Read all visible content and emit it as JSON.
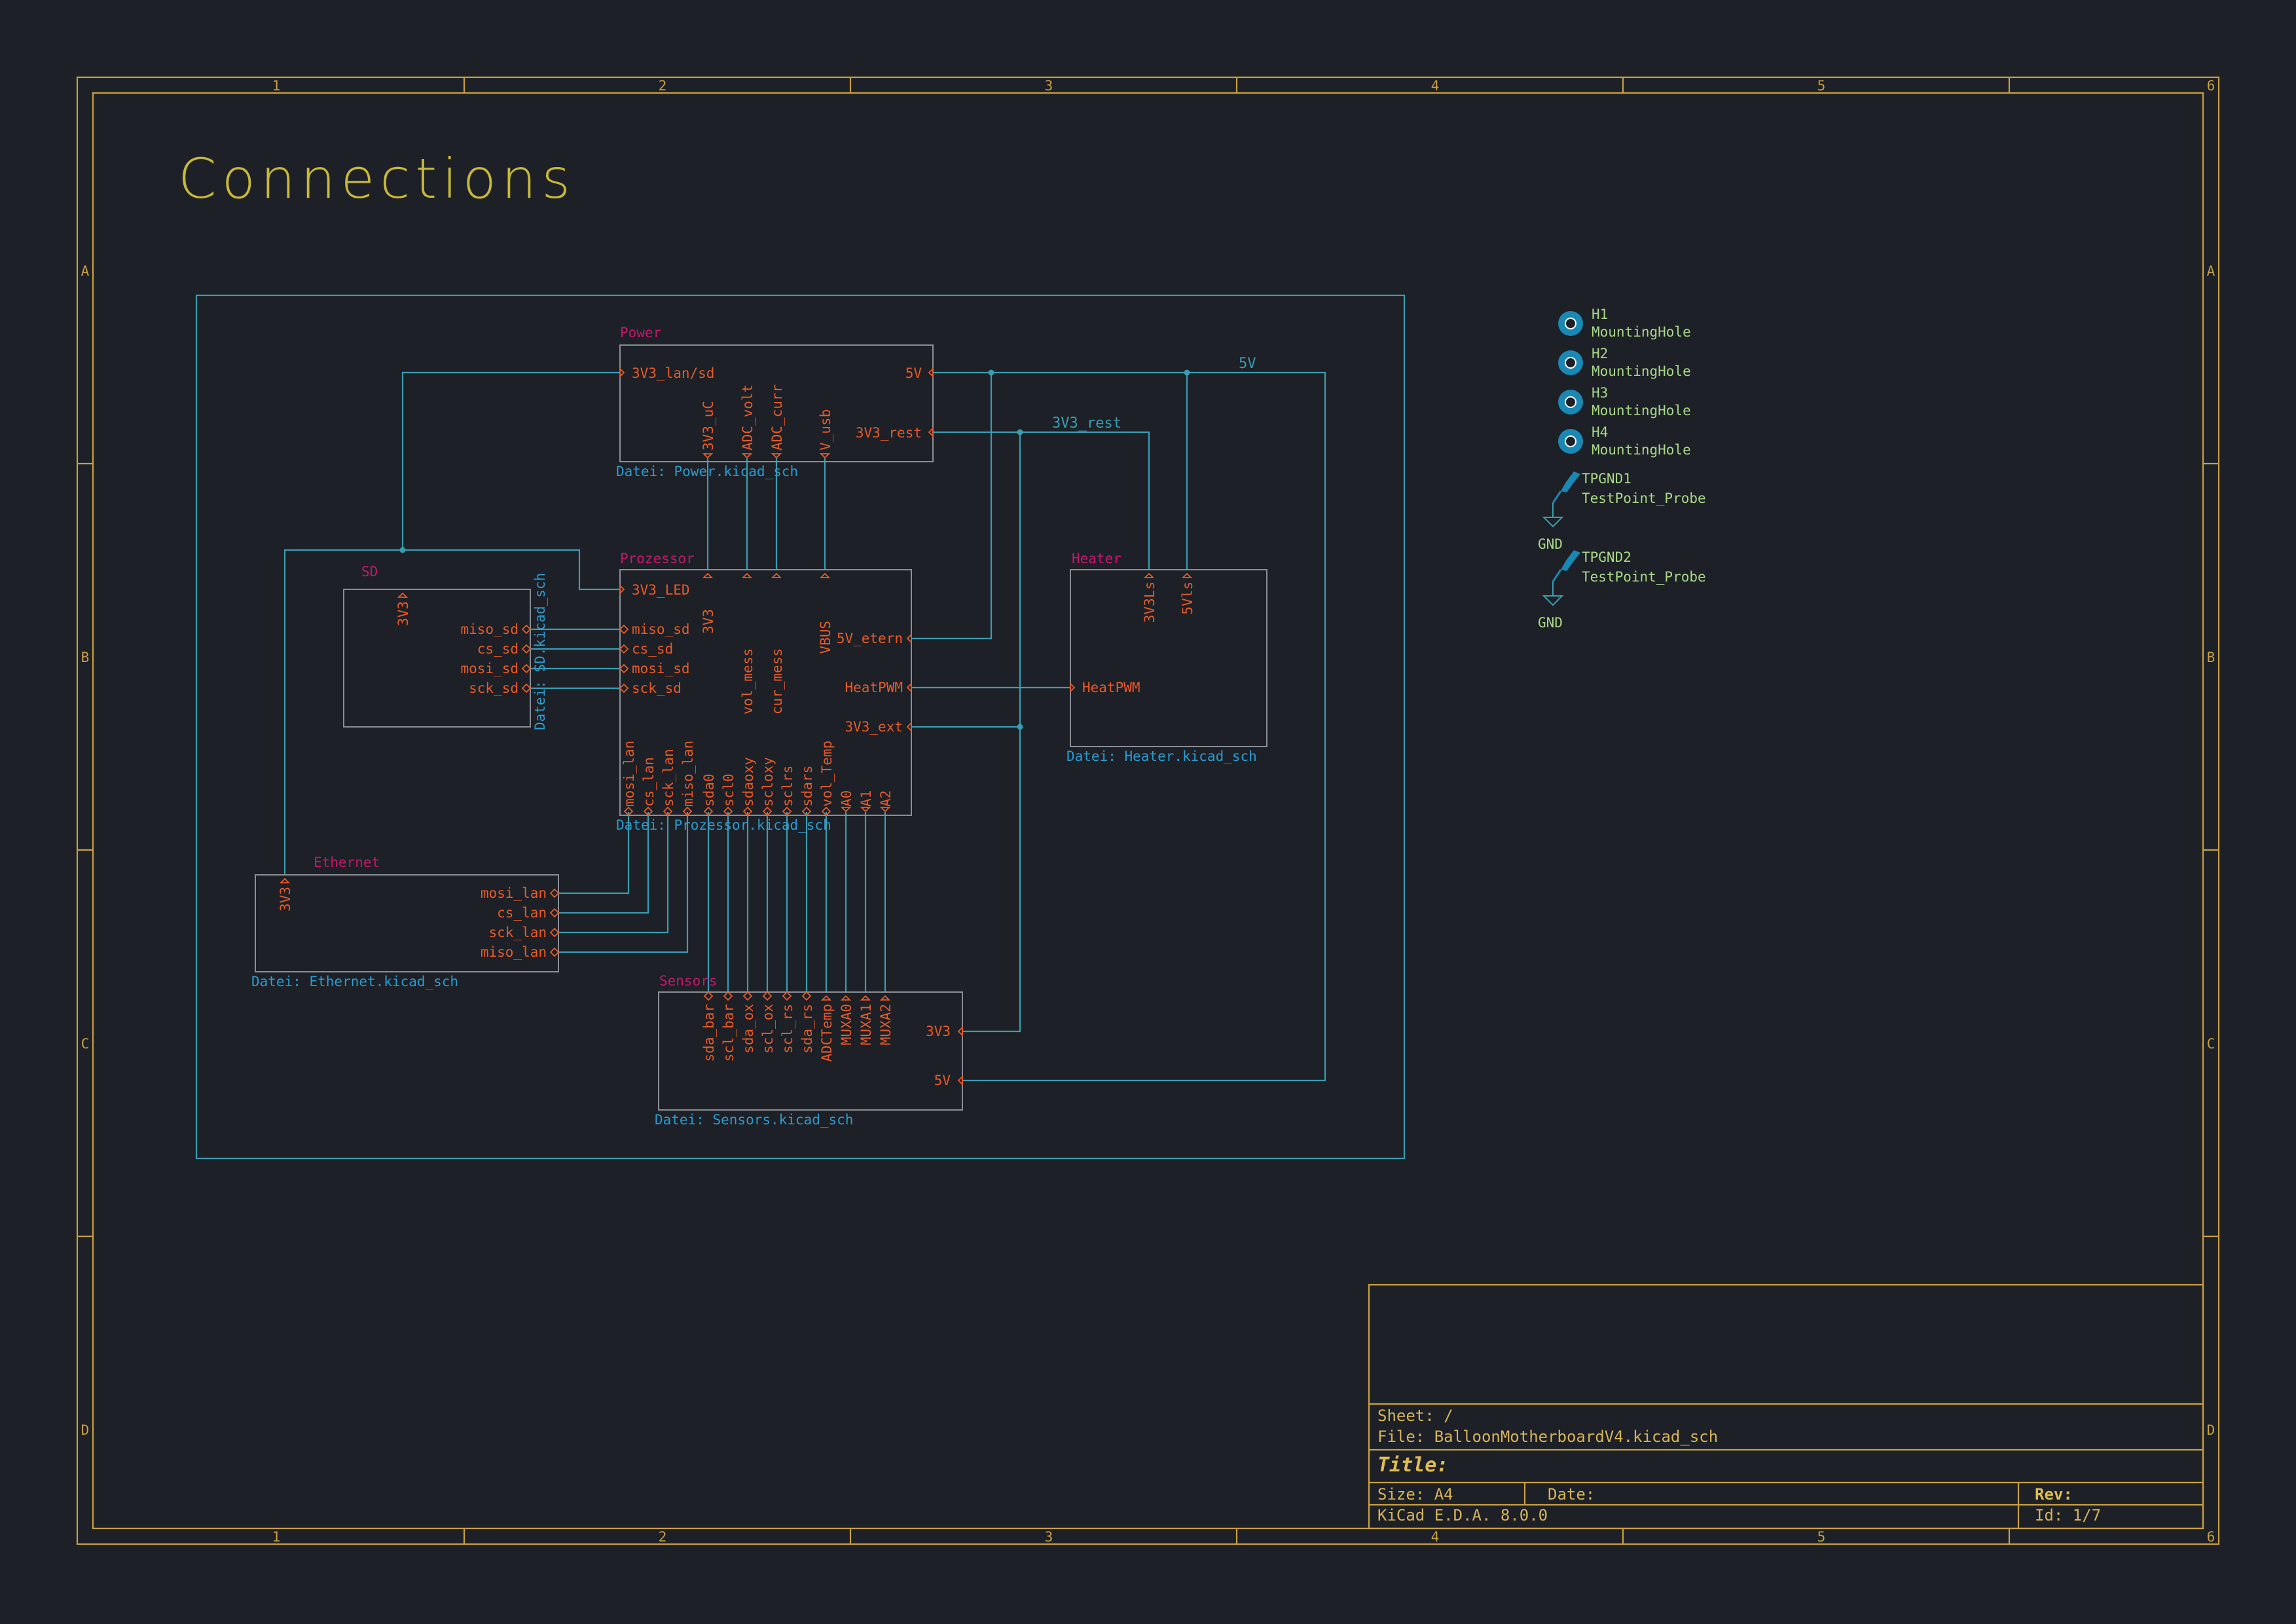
{
  "title": "Connections",
  "frame": {
    "cols": [
      "1",
      "2",
      "3",
      "4",
      "5",
      "6"
    ],
    "rows": [
      "A",
      "B",
      "C",
      "D"
    ]
  },
  "title_block": {
    "sheet": "Sheet: /",
    "file": "File: BalloonMotherboardV4.kicad_sch",
    "title": "Title:",
    "size": "Size: A4",
    "date": "Date:",
    "rev": "Rev:",
    "kicad": "KiCad E.D.A. 8.0.0",
    "id": "Id: 1/7"
  },
  "sheets": {
    "power": {
      "name": "Power",
      "file": "Datei: Power.kicad_sch",
      "pins": {
        "p3v3_lan": "3V3_lan/sd",
        "p5v": "5V",
        "p3v3_rest": "3V3_rest",
        "p3v3_uc": "3V3_uC",
        "padc_volt": "ADC_volt",
        "padc_curr": "ADC_curr",
        "pv_usb": "V_usb"
      }
    },
    "prozessor": {
      "name": "Prozessor",
      "file": "Datei: Prozessor.kicad_sch",
      "pins": {
        "p3v3_led": "3V3_LED",
        "miso_sd": "miso_sd",
        "cs_sd": "cs_sd",
        "mosi_sd": "mosi_sd",
        "sck_sd": "sck_sd",
        "p3v3": "3V3",
        "vol_mess": "vol_mess",
        "cur_mess": "cur_mess",
        "vbus": "VBUS",
        "p5v_etern": "5V_etern",
        "heatpwm": "HeatPWM",
        "p3v3_ext": "3V3_ext",
        "mosi_lan": "mosi_lan",
        "cs_lan": "cs_lan",
        "sck_lan": "sck_lan",
        "miso_lan": "miso_lan",
        "sda0": "sda0",
        "scl0": "scl0",
        "sdaoxy": "sdaoxy",
        "scloxy": "scloxy",
        "sclrs": "sclrs",
        "sdars": "sdars",
        "vol_temp": "vol_Temp",
        "a0": "A0",
        "a1": "A1",
        "a2": "A2"
      }
    },
    "sd": {
      "name": "SD",
      "file": "Datei: SD.kicad_sch",
      "pins": {
        "p3v3": "3V3",
        "miso_sd": "miso_sd",
        "cs_sd": "cs_sd",
        "mosi_sd": "mosi_sd",
        "sck_sd": "sck_sd"
      }
    },
    "heater": {
      "name": "Heater",
      "file": "Datei: Heater.kicad_sch",
      "pins": {
        "p3v3ls": "3V3Ls",
        "p5vls": "5Vls",
        "heatpwm": "HeatPWM"
      }
    },
    "ethernet": {
      "name": "Ethernet",
      "file": "Datei: Ethernet.kicad_sch",
      "pins": {
        "p3v3": "3V3",
        "mosi_lan": "mosi_lan",
        "cs_lan": "cs_lan",
        "sck_lan": "sck_lan",
        "miso_lan": "miso_lan"
      }
    },
    "sensors": {
      "name": "Sensors",
      "file": "Datei: Sensors.kicad_sch",
      "pins": {
        "sda_bar": "sda_bar",
        "scl_bar": "scl_bar",
        "sda_ox": "sda_ox",
        "scl_ox": "scl_ox",
        "scl_rs": "scl_rs",
        "sda_rs": "sda_rs",
        "adctemp": "ADCTemp",
        "muxa0": "MUXA0",
        "muxa1": "MUXA1",
        "muxa2": "MUXA2",
        "p3v3": "3V3",
        "p5v": "5V"
      }
    }
  },
  "net_labels": {
    "net_5v": "5V",
    "net_3v3_rest": "3V3_rest"
  },
  "parts": {
    "h1": {
      "ref": "H1",
      "value": "MountingHole"
    },
    "h2": {
      "ref": "H2",
      "value": "MountingHole"
    },
    "h3": {
      "ref": "H3",
      "value": "MountingHole"
    },
    "h4": {
      "ref": "H4",
      "value": "MountingHole"
    },
    "tp1": {
      "ref": "TPGND1",
      "value": "TestPoint_Probe",
      "gnd": "GND"
    },
    "tp2": {
      "ref": "TPGND2",
      "value": "TestPoint_Probe",
      "gnd": "GND"
    }
  },
  "colors": {
    "background": "#1d2026",
    "frame": "#c8a040",
    "wire": "#3a9cb0",
    "pin": "#e85a2a",
    "sheet_name": "#c4186e",
    "sheet_file": "#2c9bd0",
    "symbol": "#1a88b4"
  }
}
